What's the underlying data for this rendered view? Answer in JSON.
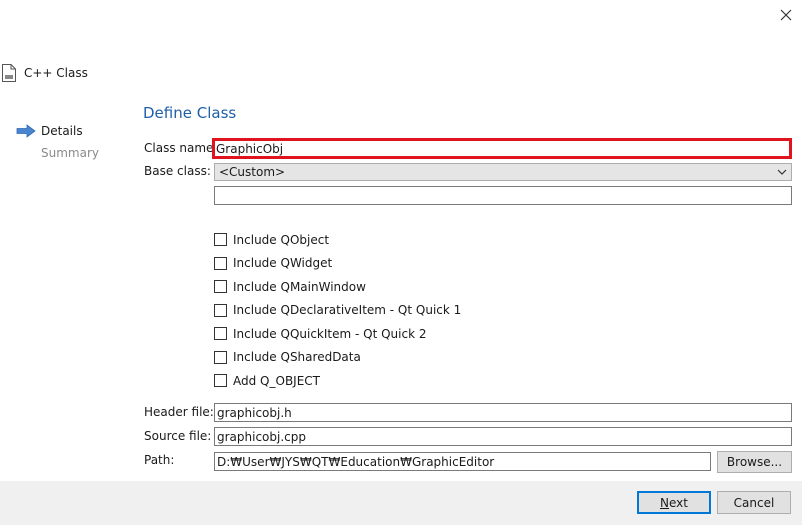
{
  "window": {
    "close_icon": "close-icon",
    "wizard_title": "C++ Class",
    "wizard_icon": "file-icon"
  },
  "steps": [
    {
      "label": "Details",
      "state": "current",
      "icon": "arrow-right-icon"
    },
    {
      "label": "Summary",
      "state": "pending"
    }
  ],
  "page_title": "Define Class",
  "form": {
    "class_name_label": "Class name:",
    "class_name_value": "GraphicObj",
    "base_class_label": "Base class:",
    "base_class_value": "<Custom>",
    "custom_base_value": "",
    "header_file_label": "Header file:",
    "header_file_value": "graphicobj.h",
    "source_file_label": "Source file:",
    "source_file_value": "graphicobj.cpp",
    "path_label": "Path:",
    "path_value": "D:₩User₩JYS₩QT₩Education₩GraphicEditor",
    "browse_label": "Browse..."
  },
  "checkboxes": [
    {
      "label": "Include QObject",
      "checked": false
    },
    {
      "label": "Include QWidget",
      "checked": false
    },
    {
      "label": "Include QMainWindow",
      "checked": false
    },
    {
      "label": "Include QDeclarativeItem - Qt Quick 1",
      "checked": false
    },
    {
      "label": "Include QQuickItem - Qt Quick 2",
      "checked": false
    },
    {
      "label": "Include QSharedData",
      "checked": false
    },
    {
      "label": "Add Q_OBJECT",
      "checked": false
    }
  ],
  "buttons": {
    "next_mnemonic": "N",
    "next_rest": "ext",
    "cancel": "Cancel"
  },
  "colors": {
    "accent": "#1f5fa8",
    "highlight_border": "#e0141e",
    "default_button_border": "#0078d7",
    "step_arrow": "#4a86d0"
  }
}
